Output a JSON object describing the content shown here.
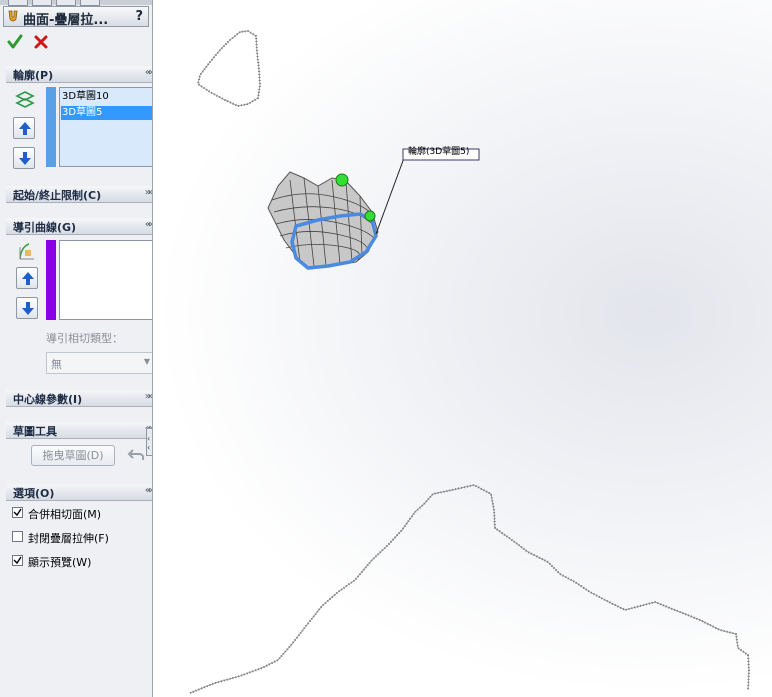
{
  "feature": {
    "title": "曲面-疊層拉...",
    "help": "?"
  },
  "profiles": {
    "header": "輪廓(P)",
    "items": [
      "3D草圖10",
      "3D草圖5"
    ],
    "selected_index": 1
  },
  "start_end": {
    "header": "起始/終止限制(C)"
  },
  "guide_curves": {
    "header": "導引曲線(G)",
    "tangency_label": "導引相切類型：",
    "tangency_value": "無"
  },
  "centerline": {
    "header": "中心線參數(I)"
  },
  "sketch_tools": {
    "header": "草圖工具",
    "drag_button": "拖曳草圖(D)"
  },
  "options": {
    "header": "選項(O)",
    "items": [
      {
        "label": "合併相切面(M)",
        "checked": true
      },
      {
        "label": "封閉疊層拉伸(F)",
        "checked": false
      },
      {
        "label": "顯示預覽(W)",
        "checked": true
      }
    ]
  },
  "viewport": {
    "callout": "輪廓(3D草圖5)"
  },
  "colors": {
    "selection": "#3399ff",
    "profile_bar": "#5aa0e6",
    "guide_bar": "#8a00e6",
    "ok": "#2e9a2e",
    "cancel": "#d01616",
    "preview_edge": "#4a8ae0",
    "handle": "#33dd33"
  }
}
